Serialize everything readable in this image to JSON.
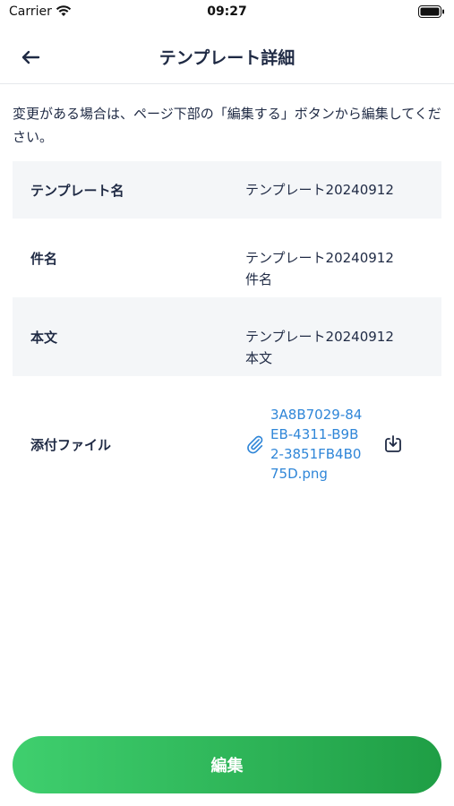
{
  "status_bar": {
    "carrier": "Carrier",
    "time": "09:27"
  },
  "header": {
    "title": "テンプレート詳細",
    "back_icon": "arrow-left-icon"
  },
  "notice": "変更がある場合は、ページ下部の「編集する」ボタンから編集してください。",
  "rows": [
    {
      "label": "テンプレート名",
      "value": "テンプレート20240912"
    },
    {
      "label": "件名",
      "value": "テンプレート20240912\n件名"
    },
    {
      "label": "本文",
      "value": "テンプレート20240912\n本文"
    }
  ],
  "attachment": {
    "label": "添付ファイル",
    "filename": "3A8B7029-84EB-4311-B9B2-3851FB4B075D.png",
    "icons": [
      "paperclip-icon",
      "download-icon"
    ]
  },
  "edit_button": {
    "label": "編集"
  },
  "colors": {
    "accent_green_start": "#3fcf6e",
    "accent_green_end": "#1f9e45",
    "link_blue": "#2f86d8",
    "text_navy": "#1f2a44",
    "row_shade": "#f4f6f8"
  }
}
